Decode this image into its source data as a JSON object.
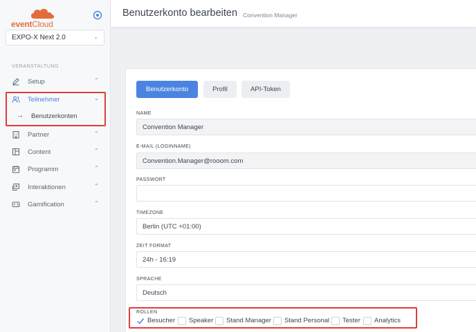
{
  "brand": {
    "event": "event",
    "cloud": "Cloud"
  },
  "event_select": {
    "value": "EXPO-X Next 2.0"
  },
  "sidebar": {
    "section_label": "VERANSTALTUNG",
    "items": [
      {
        "label": "Setup",
        "icon": "pencil-icon"
      },
      {
        "label": "Teilnehmer",
        "icon": "users-icon"
      },
      {
        "label": "Partner",
        "icon": "building-icon"
      },
      {
        "label": "Content",
        "icon": "layout-icon"
      },
      {
        "label": "Programm",
        "icon": "calendar-icon"
      },
      {
        "label": "Interaktionen",
        "icon": "chat-icon"
      },
      {
        "label": "Gamification",
        "icon": "gamepad-icon"
      }
    ],
    "sub_item": {
      "label": "Benutzerkonten"
    }
  },
  "header": {
    "title": "Benutzerkonto bearbeiten",
    "subtitle": "Convention Manager"
  },
  "tabs": [
    {
      "label": "Benutzerkonto"
    },
    {
      "label": "Profil"
    },
    {
      "label": "API-Token"
    }
  ],
  "form": {
    "name": {
      "label": "NAME",
      "value": "Convention Manager"
    },
    "email": {
      "label": "E-MAIL (LOGINNAME)",
      "value": "Convention.Manager@rooom.com"
    },
    "password": {
      "label": "PASSWORT",
      "value": ""
    },
    "timezone": {
      "label": "TIMEZONE",
      "value": "Berlin (UTC +01:00)"
    },
    "time_format": {
      "label": "ZEIT FORMAT",
      "value": "24h - 16:19"
    },
    "language": {
      "label": "SPRACHE",
      "value": "Deutsch"
    },
    "roles": {
      "label": "ROLLEN",
      "options": [
        {
          "label": "Besucher",
          "checked": true
        },
        {
          "label": "Speaker",
          "checked": false
        },
        {
          "label": "Stand Manager",
          "checked": false
        },
        {
          "label": "Stand Personal",
          "checked": false
        },
        {
          "label": "Tester",
          "checked": false
        },
        {
          "label": "Analytics",
          "checked": false
        }
      ]
    }
  },
  "colors": {
    "accent": "#4a84e0",
    "brand": "#e36d3a",
    "highlight": "#e03b3b"
  }
}
